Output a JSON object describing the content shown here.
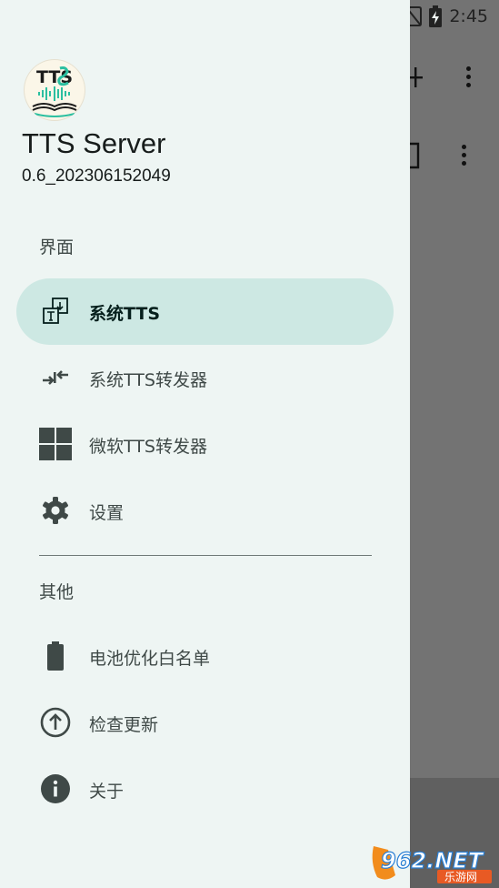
{
  "status_bar": {
    "time": "2:45",
    "icons": [
      "wifi-icon",
      "no-sim-icon",
      "battery-charging-icon"
    ]
  },
  "drawer": {
    "app_name": "TTS Server",
    "app_version": "0.6_202306152049",
    "logo_text": "TTS",
    "sections": [
      {
        "title": "界面",
        "items": [
          {
            "label": "系统TTS",
            "icon": "system-tts-icon",
            "active": true
          },
          {
            "label": "系统TTS转发器",
            "icon": "forward-icon",
            "active": false
          },
          {
            "label": "微软TTS转发器",
            "icon": "windows-icon",
            "active": false
          },
          {
            "label": "设置",
            "icon": "gear-icon",
            "active": false
          }
        ]
      },
      {
        "title": "其他",
        "items": [
          {
            "label": "电池优化白名单",
            "icon": "battery-icon",
            "active": false
          },
          {
            "label": "检查更新",
            "icon": "arrow-up-circle-icon",
            "active": false
          },
          {
            "label": "关于",
            "icon": "info-icon",
            "active": false
          }
        ]
      }
    ]
  },
  "background": {
    "icons": [
      "add-icon",
      "more-vert-icon",
      "more-vert-icon",
      "square-icon"
    ]
  },
  "watermark": {
    "text_main": "962.NET",
    "text_sub": "乐游网"
  },
  "colors": {
    "drawer_bg": "#eef5f3",
    "active_item_bg": "#cde8e3",
    "text_primary": "#171c1b",
    "text_secondary": "#3f4947",
    "scrim": "#737373",
    "logo_accent": "#2bbfa0"
  }
}
